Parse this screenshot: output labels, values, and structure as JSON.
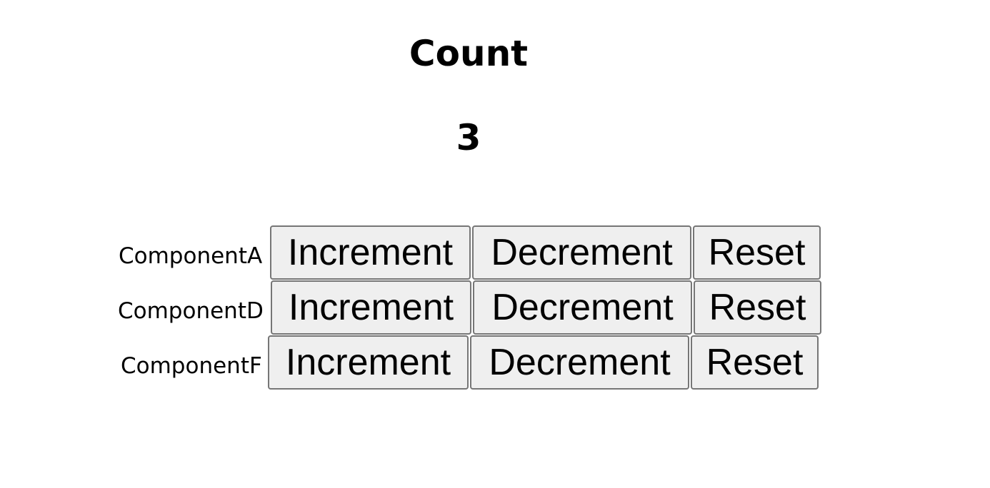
{
  "header": {
    "title": "Count",
    "count_value": "3"
  },
  "rows": [
    {
      "label": "ComponentA",
      "increment": "Increment",
      "decrement": "Decrement",
      "reset": "Reset"
    },
    {
      "label": "ComponentD",
      "increment": "Increment",
      "decrement": "Decrement",
      "reset": "Reset"
    },
    {
      "label": "ComponentF",
      "increment": "Increment",
      "decrement": "Decrement",
      "reset": "Reset"
    }
  ],
  "colors": {
    "button_background": "#efefef",
    "button_border": "#767676",
    "text": "#000000",
    "page_background": "#ffffff"
  }
}
